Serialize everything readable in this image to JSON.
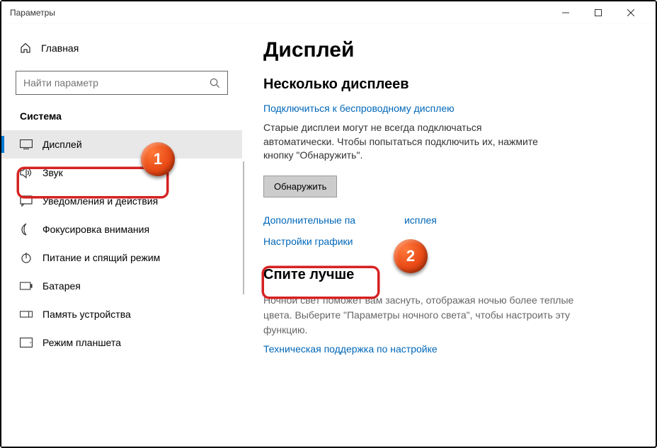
{
  "window": {
    "title": "Параметры"
  },
  "sidebar": {
    "home": "Главная",
    "search_placeholder": "Найти параметр",
    "section": "Система",
    "items": [
      {
        "label": "Дисплей"
      },
      {
        "label": "Звук"
      },
      {
        "label": "Уведомления и действия"
      },
      {
        "label": "Фокусировка внимания"
      },
      {
        "label": "Питание и спящий режим"
      },
      {
        "label": "Батарея"
      },
      {
        "label": "Память устройства"
      },
      {
        "label": "Режим планшета"
      }
    ]
  },
  "main": {
    "title": "Дисплей",
    "multi_heading": "Несколько дисплеев",
    "wireless_link": "Подключиться к беспроводному дисплею",
    "old_displays_text": "Старые дисплеи могут не всегда подключаться автоматически. Чтобы попытаться подключить их, нажмите кнопку \"Обнаружить\".",
    "detect_btn": "Обнаружить",
    "advanced_link_part1": "Дополнительные па",
    "advanced_link_part2": "исплея",
    "graphics_link": "Настройки графики",
    "sleep_heading": "Спите лучше",
    "sleep_text": "Ночной свет поможет вам заснуть, отображая ночью более теплые цвета. Выберите \"Параметры ночного света\", чтобы настроить эту функцию.",
    "support_link": "Техническая поддержка по настройке"
  },
  "badges": {
    "one": "1",
    "two": "2"
  }
}
